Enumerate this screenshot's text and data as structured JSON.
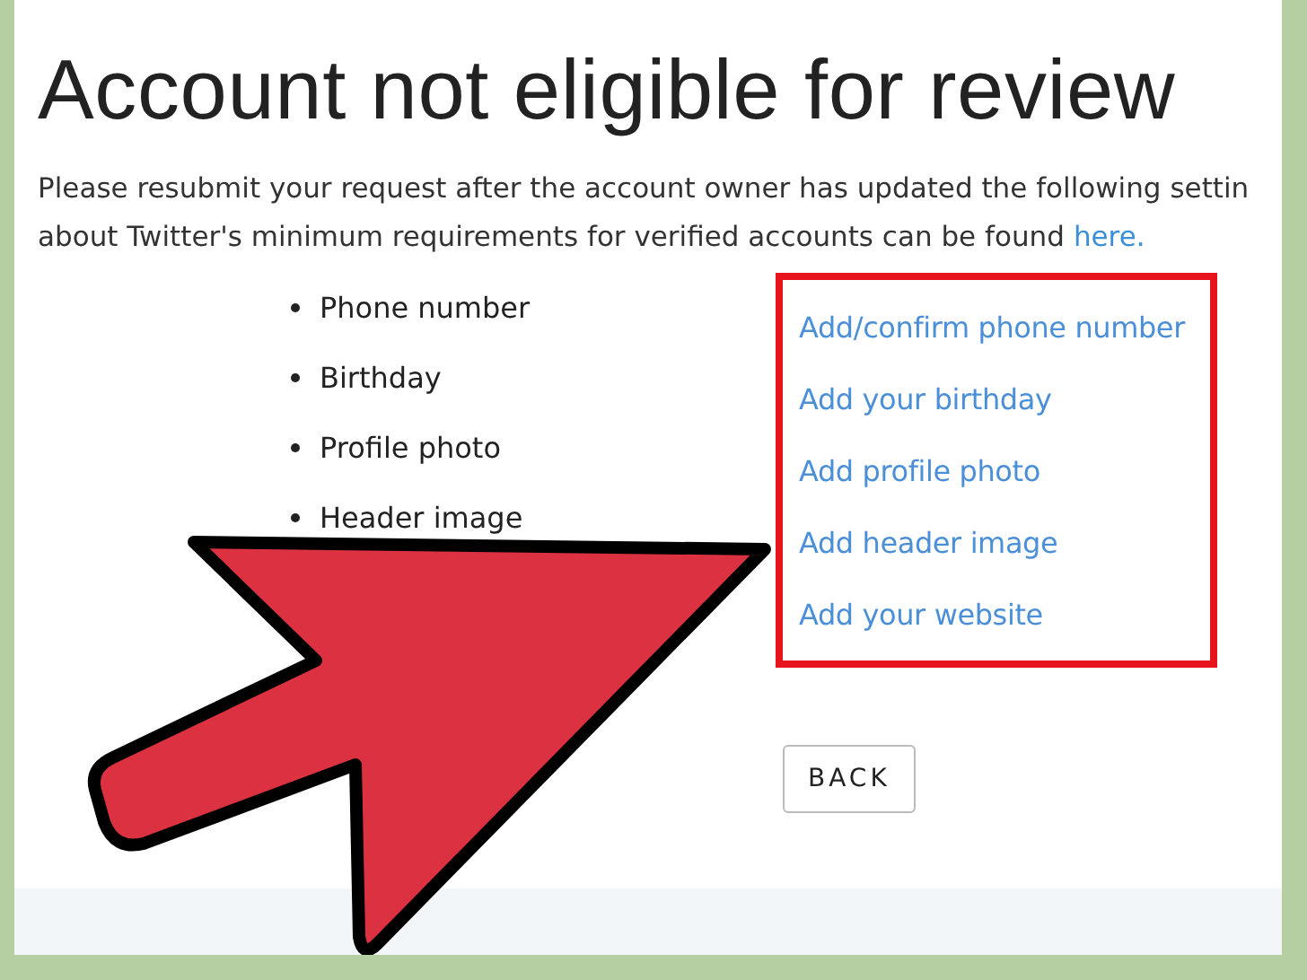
{
  "title": "Account not eligible for review",
  "intro": {
    "line_1": "Please resubmit your request after the account owner has updated the following settin",
    "line_2": "about Twitter's minimum requirements for verified accounts can be found",
    "link": "here."
  },
  "requirements": [
    {
      "label": "Phone number",
      "action": "Add/confirm phone number"
    },
    {
      "label": "Birthday",
      "action": "Add your birthday"
    },
    {
      "label": "Profile photo",
      "action": "Add profile photo"
    },
    {
      "label": "Header image",
      "action": "Add header image"
    },
    {
      "action": "Add your website"
    }
  ],
  "back_button": "BACK"
}
